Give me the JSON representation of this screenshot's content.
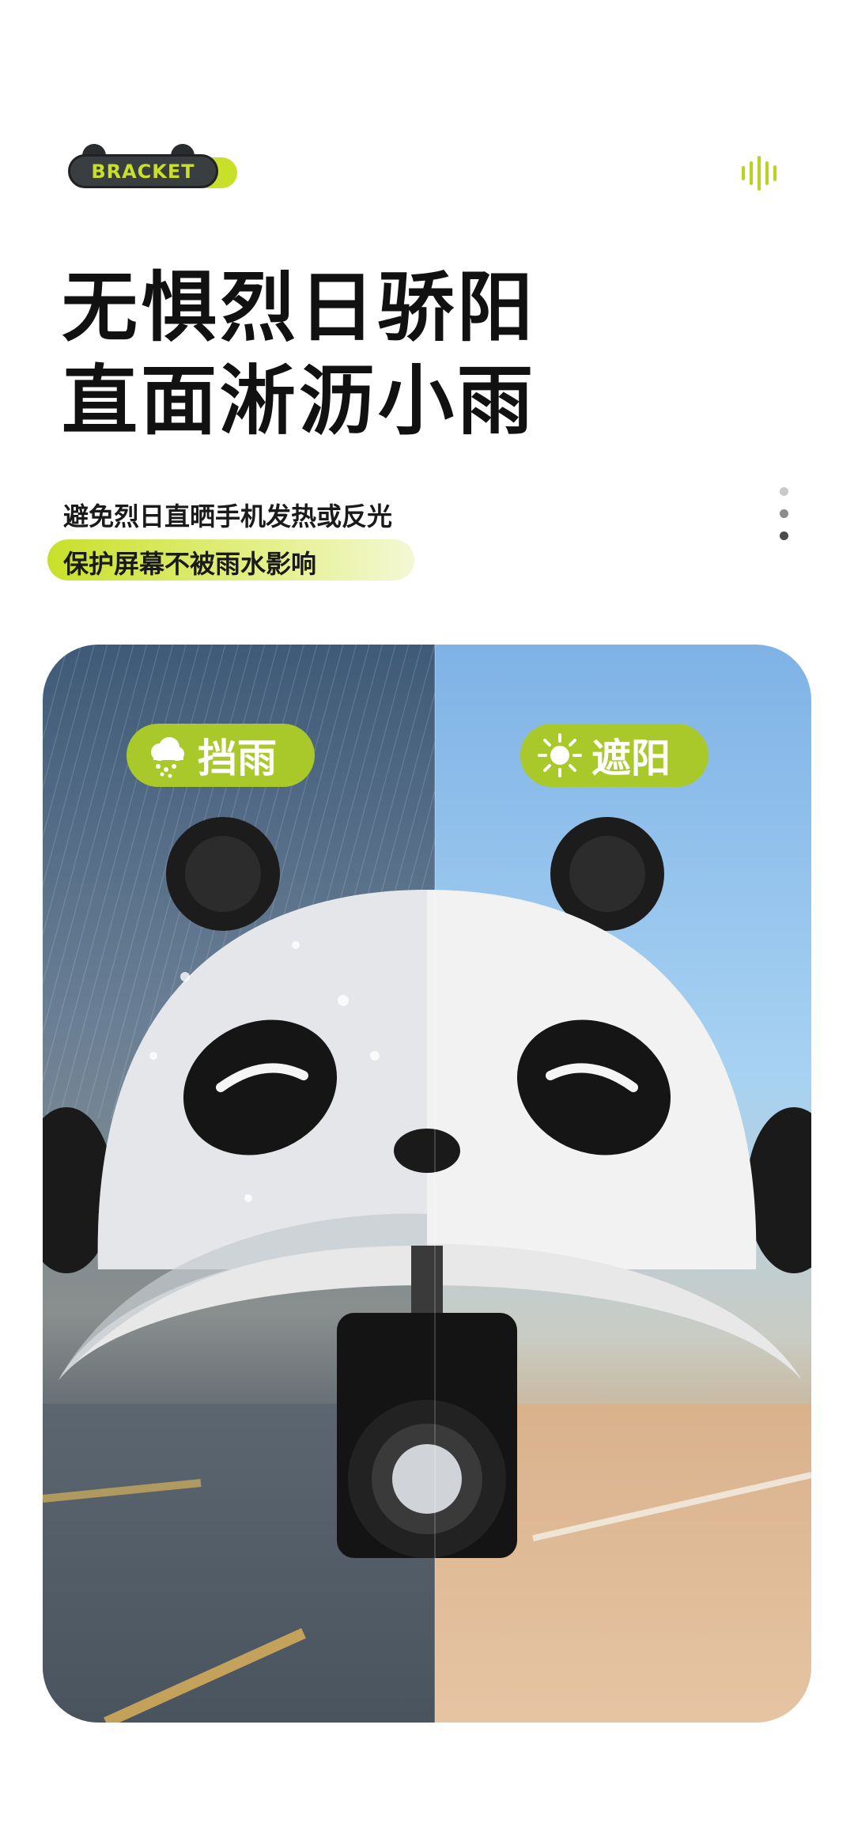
{
  "badge": {
    "label": "BRACKET"
  },
  "icons": {
    "wave": "sound-wave-icon",
    "dots": "vertical-dots-icon",
    "rain": "cloud-rain-icon",
    "sun": "sun-icon"
  },
  "headline": {
    "line1": "无惧烈日骄阳",
    "line2": "直面淅沥小雨"
  },
  "subtitle": {
    "line1": "避免烈日直晒手机发热或反光",
    "line2": "保护屏幕不被雨水影响"
  },
  "card": {
    "rain_label": "挡雨",
    "sun_label": "遮阳"
  },
  "colors": {
    "accent": "#c8e02a",
    "tag": "#a9c82a",
    "text": "#111111"
  }
}
